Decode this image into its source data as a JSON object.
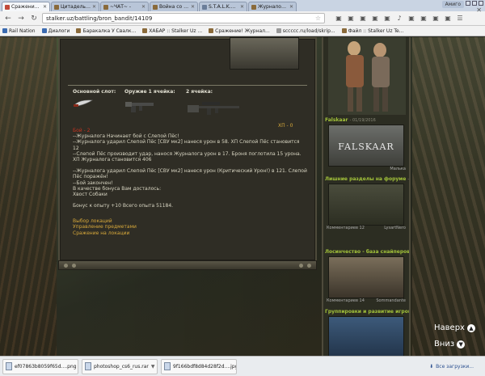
{
  "tabs": [
    {
      "title": "Сражение! Журналога пр",
      "color": "#c24a3a",
      "active": true
    },
    {
      "title": "Цитадель Ордена с Форум",
      "color": "#8a6a3a",
      "active": false
    },
    {
      "title": "~ЧАТ~ - ",
      "color": "#8a6a3a",
      "active": false
    },
    {
      "title": "Война со Тараз",
      "color": "#8a6a3a",
      "active": false
    },
    {
      "title": "S.T.A.L.K.E.R. Группировки",
      "color": "#6b7e9a",
      "active": false
    },
    {
      "title": "Журналога - 49 уровень",
      "color": "#8a6a3a",
      "active": false
    }
  ],
  "profile": "Амиго",
  "address": "stalker.uz/battling/bron_bandit/14109",
  "bookmarks": [
    {
      "label": "Rail Nation",
      "color": "#3a6ab0"
    },
    {
      "label": "Диалоги",
      "color": "#3a6ab0"
    },
    {
      "label": "Баракалка У Свалк...",
      "color": "#8a6a3a"
    },
    {
      "label": "ХАБАР :: Stalker Uz ...",
      "color": "#8a6a3a"
    },
    {
      "label": "Сражение! Журнал...",
      "color": "#8a6a3a"
    },
    {
      "label": "sccccc.ru/load/skrip...",
      "color": "#999999"
    },
    {
      "label": "Файл :: Stalker Uz Te...",
      "color": "#8a6a3a"
    }
  ],
  "slots": {
    "main_label": "Основной слот:",
    "weapon1_label": "Оружие 1 ячейка:",
    "weapon2_label": "2 ячейка:"
  },
  "xp_label": "ХП - 0",
  "log": {
    "heading": "Бой - 2 ",
    "lines": [
      "--Журналога Начинает бой с Слепой Пёс!",
      "--Журналога ударил Слепой Пёс [СВУ мк2] нанеся урон в 58. ХП Слепой Пёс становится 12",
      "--Слепой Пёс производит удар, нанося Журналога урон в 17. Броня поглотила 15 урона. ХП Журналога становится 406",
      "",
      "--Журналога ударил Слепой Пёс [СВУ мк2] нанеся урон (Критический Урон!) в 121. Слепой Пёс поражён!",
      "--Бой закончен!",
      "В качестве бонуса Вам досталось:",
      "Хвост Собаки",
      "",
      "Бонус к опыту +10 Всего опыта 51184."
    ]
  },
  "links": [
    "Выбор локаций",
    "Управление предметами",
    "Сражение на локации"
  ],
  "sidebar": {
    "news": [
      {
        "title": "Falskaar",
        "date": "- 01/19/2016",
        "logo": "FALSKAAR",
        "footer_left": "",
        "footer_right": "Малька"
      },
      {
        "title": "Лишние разделы на форуме",
        "date": "- 01/18/2015",
        "logo": "",
        "footer_left": "Комментариев 12",
        "footer_right": "LysartNero"
      },
      {
        "title": "Лосинчество - база снайперов",
        "date": "- 01/18/2015",
        "logo": "",
        "footer_left": "Комментариев 14",
        "footer_right": "Sommandante"
      },
      {
        "title": "Группировки и развитие игрока",
        "date": "- 01/18/2015",
        "logo": "",
        "footer_left": "",
        "footer_right": ""
      }
    ]
  },
  "scroll": {
    "up": "Наверх",
    "down": "Вниз"
  },
  "downloads": {
    "items": [
      "ef07863b8059f65d....png",
      "photoshop_cs6_rus.rar",
      "9f166bdf8d84d28f2d....jpg"
    ],
    "all_label": "Все загрузки..."
  }
}
